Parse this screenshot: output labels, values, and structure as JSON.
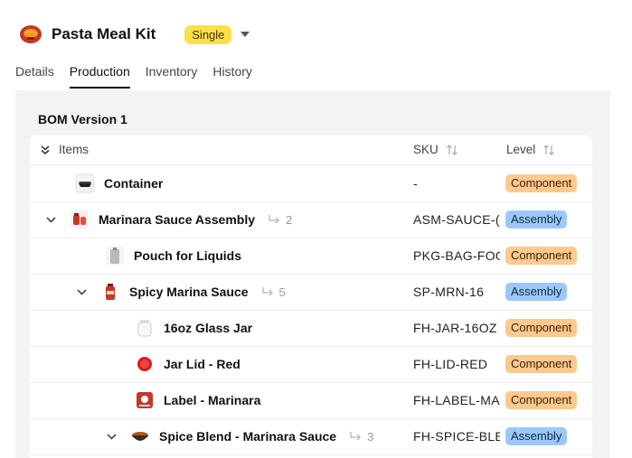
{
  "header": {
    "title": "Pasta Meal Kit",
    "type_badge": "Single",
    "thumb_icon": "pasta-kit-icon"
  },
  "tabs": [
    {
      "label": "Details",
      "active": false
    },
    {
      "label": "Production",
      "active": true
    },
    {
      "label": "Inventory",
      "active": false
    },
    {
      "label": "History",
      "active": false
    }
  ],
  "bom": {
    "title": "BOM Version 1",
    "columns": {
      "items": "Items",
      "sku": "SKU",
      "level": "Level"
    },
    "rows": [
      {
        "name": "Container",
        "sku": "-",
        "level": "Component",
        "level_type": "component",
        "icon": "container-icon"
      },
      {
        "name": "Marinara Sauce Assembly",
        "sku": "ASM-SAUCE-(",
        "level": "Assembly",
        "level_type": "assembly",
        "count": "2",
        "icon": "sauce-assembly-icon"
      },
      {
        "name": "Pouch for Liquids",
        "sku": "PKG-BAG-FOO",
        "level": "Component",
        "level_type": "component",
        "icon": "pouch-icon"
      },
      {
        "name": "Spicy Marina Sauce",
        "sku": "SP-MRN-16",
        "level": "Assembly",
        "level_type": "assembly",
        "count": "5",
        "icon": "sauce-bottle-icon"
      },
      {
        "name": "16oz Glass Jar",
        "sku": "FH-JAR-16OZ",
        "level": "Component",
        "level_type": "component",
        "icon": "glass-jar-icon"
      },
      {
        "name": "Jar Lid - Red",
        "sku": "FH-LID-RED",
        "level": "Component",
        "level_type": "component",
        "icon": "red-lid-icon"
      },
      {
        "name": "Label - Marinara",
        "sku": "FH-LABEL-MA",
        "level": "Component",
        "level_type": "component",
        "icon": "label-icon"
      },
      {
        "name": "Spice Blend - Marinara Sauce",
        "sku": "FH-SPICE-BLE",
        "level": "Assembly",
        "level_type": "assembly",
        "count": "3",
        "icon": "spice-bowl-icon"
      }
    ]
  },
  "colors": {
    "badge_yellow": "#fde047",
    "component": "#fdc98f",
    "assembly": "#9cc8f7",
    "panel_bg": "#f3f3f4"
  }
}
